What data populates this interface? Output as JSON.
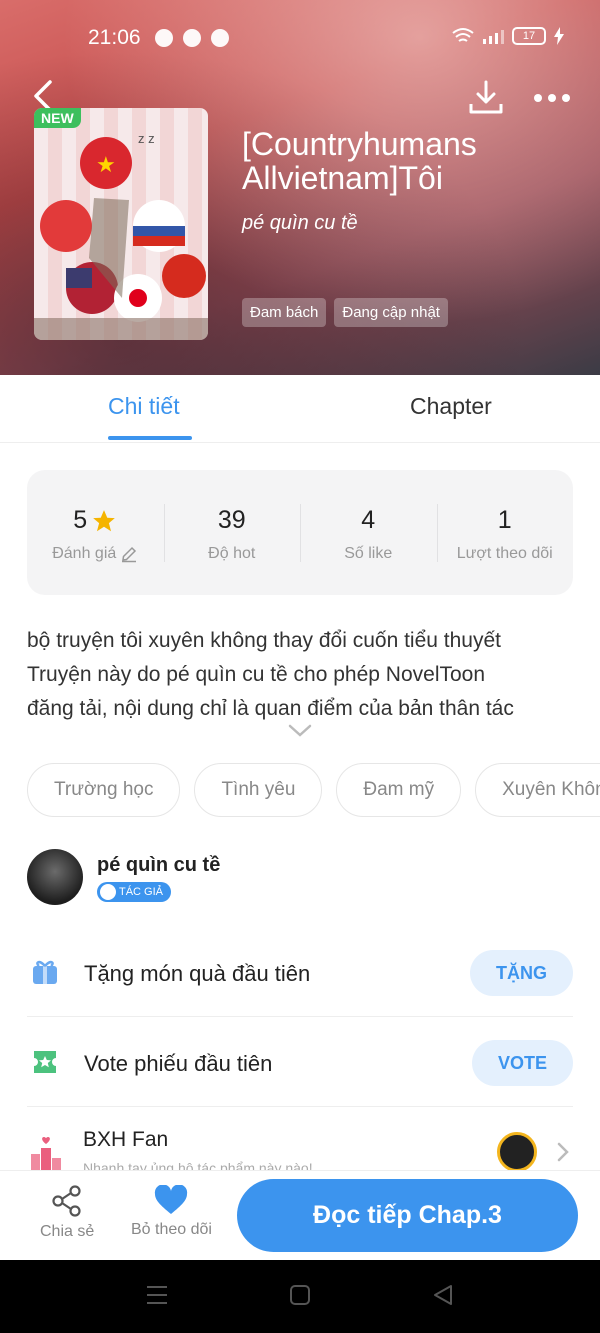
{
  "status": {
    "time": "21:06",
    "battery": "17"
  },
  "header": {
    "badge": "NEW",
    "title": "[Countryhumans Allvietnam]Tôi",
    "author": "pé quìn cu tề",
    "tags": [
      "Đam bách",
      "Đang cập nhật"
    ]
  },
  "tabs": {
    "active": "Chi tiết",
    "other": "Chapter"
  },
  "stats": [
    {
      "value": "5",
      "label": "Đánh giá"
    },
    {
      "value": "39",
      "label": "Độ hot"
    },
    {
      "value": "4",
      "label": "Số like"
    },
    {
      "value": "1",
      "label": "Lượt theo dõi"
    }
  ],
  "description": {
    "line1": "bộ truyện tôi xuyên không thay đổi cuốn tiểu thuyết",
    "line2": "Truyện này do pé quìn cu tề cho phép NovelToon",
    "line3": "đăng tải, nội dung chỉ là quan điểm của bản thân tác"
  },
  "genres": [
    "Trường học",
    "Tình yêu",
    "Đam mỹ",
    "Xuyên Không"
  ],
  "author_row": {
    "name": "pé quìn cu tề",
    "badge": "TÁC GIẢ"
  },
  "actions": {
    "gift": {
      "label": "Tặng món quà đầu tiên",
      "button": "TẶNG"
    },
    "vote": {
      "label": "Vote phiếu đầu tiên",
      "button": "VOTE"
    }
  },
  "fan": {
    "label": "BXH Fan",
    "sub": "Nhanh tay ủng hộ tác phẩm này nào!"
  },
  "bottom": {
    "share": "Chia sẻ",
    "unfollow": "Bỏ theo dõi",
    "read": "Đọc tiếp Chap.3"
  },
  "colors": {
    "accent": "#3c94ee",
    "new_badge": "#3dbf5d",
    "star": "#f5b400"
  },
  "icons": [
    "back-icon",
    "download-icon",
    "more-icon",
    "star-icon",
    "edit-icon",
    "chevron-down-icon",
    "gift-icon",
    "vote-ticket-icon",
    "fan-ranking-icon",
    "chevron-right-icon",
    "share-icon",
    "heart-icon"
  ]
}
